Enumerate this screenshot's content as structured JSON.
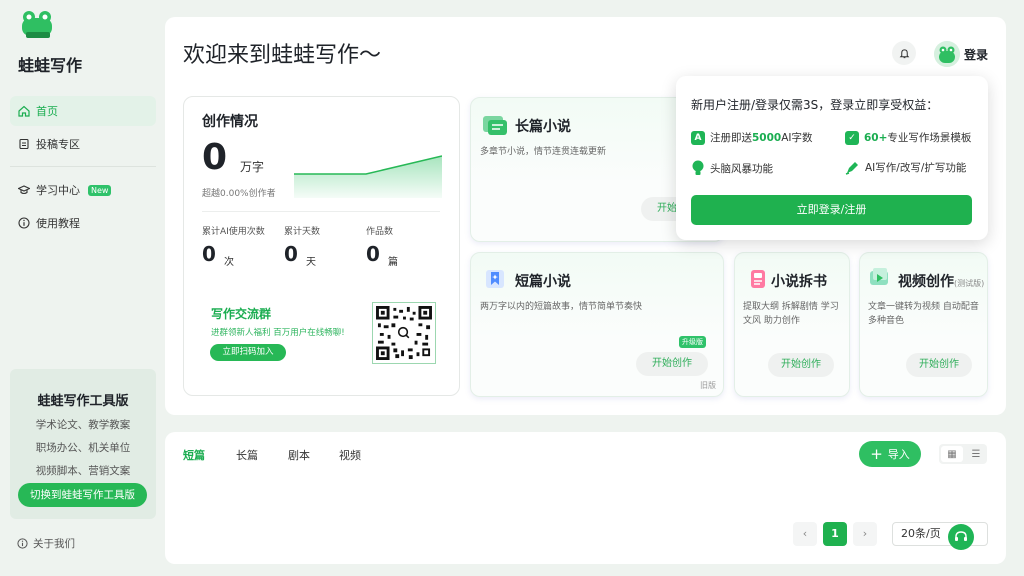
{
  "brand": {
    "name": "蛙蛙写作"
  },
  "colors": {
    "accent": "#1fb14f",
    "accent_light": "#e3f2e8"
  },
  "sidebar": {
    "items": [
      {
        "label": "首页",
        "icon": "home-icon",
        "active": true
      },
      {
        "label": "投稿专区",
        "icon": "submit-icon"
      },
      {
        "label": "学习中心",
        "icon": "graduation-icon",
        "badge": "New"
      },
      {
        "label": "使用教程",
        "icon": "info-icon"
      }
    ],
    "toolbox": {
      "title": "蛙蛙写作工具版",
      "lines": [
        "学术论文、教学教案",
        "职场办公、机关单位",
        "视频脚本、营销文案"
      ],
      "button": "切换到蛙蛙写作工具版"
    },
    "about": "关于我们"
  },
  "header": {
    "welcome": "欢迎来到蛙蛙写作～",
    "login": "登录"
  },
  "stats": {
    "title": "创作情况",
    "total": "0",
    "total_unit": "万字",
    "exceed": "超越0.00%创作者",
    "metrics": [
      {
        "label": "累计AI使用次数",
        "value": "0",
        "unit": "次"
      },
      {
        "label": "累计天数",
        "value": "0",
        "unit": "天"
      },
      {
        "label": "作品数",
        "value": "0",
        "unit": "篇"
      }
    ],
    "group": {
      "title": "写作交流群",
      "sub": "进群领新人福利 百万用户在线畅聊!",
      "button": "立即扫码加入"
    }
  },
  "features": {
    "long": {
      "title": "长篇小说",
      "desc": "多章节小说，情节连贯连载更新",
      "button": "开始创作"
    },
    "short": {
      "title": "短篇小说",
      "desc": "两万字以内的短篇故事，情节简单节奏快",
      "button": "开始创作",
      "tag": "升级版",
      "old": "旧版"
    },
    "split": {
      "title": "小说拆书",
      "desc": "提取大纲 拆解剧情 学习文风 助力创作",
      "button": "开始创作"
    },
    "video": {
      "title": "视频创作",
      "beta": "(测试版)",
      "desc": "文章一键转为视频 自动配音多种音色",
      "button": "开始创作"
    }
  },
  "popup": {
    "title": "新用户注册/登录仅需3S，登录立即享受权益：",
    "perks": [
      {
        "pre": "注册即送",
        "bold": "5000",
        "post": "AI字数",
        "icon": "letter-a-icon"
      },
      {
        "pre": "",
        "bold": "60+",
        "post": "专业写作场景模板",
        "icon": "template-icon"
      },
      {
        "pre": "头脑风暴功能",
        "bold": "",
        "post": "",
        "icon": "bulb-icon"
      },
      {
        "pre": "AI写作/改写/扩写功能",
        "bold": "",
        "post": "",
        "icon": "pen-icon"
      }
    ],
    "button": "立即登录/注册"
  },
  "works": {
    "tabs": [
      {
        "label": "短篇",
        "active": true
      },
      {
        "label": "长篇"
      },
      {
        "label": "剧本"
      },
      {
        "label": "视频"
      }
    ],
    "import": "导入",
    "page": "1",
    "page_size": "20条/页"
  }
}
